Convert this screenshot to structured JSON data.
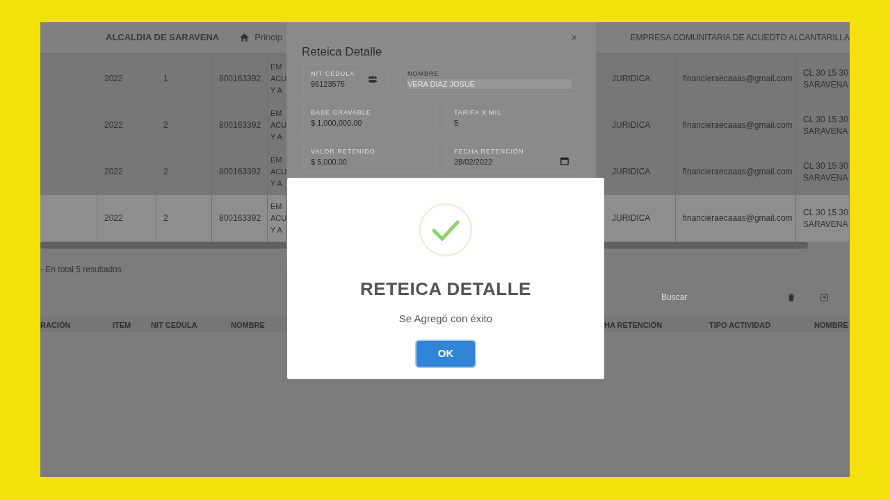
{
  "header": {
    "organization": "ALCALDIA DE SARAVENA",
    "nav_link": "Princip",
    "company": "EMPRESA COMUNITARIA DE ACUEDTO ALCANTARILLA"
  },
  "table": {
    "rows": [
      {
        "cells": [
          "2022",
          "1",
          "800163392",
          "EM\nACU\nY A",
          "JURIDICA",
          "financieraecaaas@gmail.com",
          "CL 30 15 30\nSARAVENA"
        ],
        "selected": false
      },
      {
        "cells": [
          "2022",
          "2",
          "800163392",
          "EM\nACU\nY A",
          "JURIDICA",
          "financieraecaaas@gmail.com",
          "CL 30 15 30\nSARAVENA"
        ],
        "selected": false
      },
      {
        "cells": [
          "2022",
          "2",
          "800163392",
          "EM\nACU\nY A",
          "JURIDICA",
          "financieraecaaas@gmail.com",
          "CL 30 15 30\nSARAVENA"
        ],
        "selected": false
      },
      {
        "cells": [
          "2022",
          "2",
          "800163392",
          "EM\nACU\nY A",
          "JURIDICA",
          "financieraecaaas@gmail.com",
          "CL 30 15 30\nSARAVENA"
        ],
        "selected": true
      }
    ]
  },
  "results_summary": "- En total 5 resultados",
  "search": {
    "placeholder": "Buscar"
  },
  "detail_table": {
    "columns": [
      "RACIÓN",
      "ITEM",
      "NIT CEDULA",
      "NOMBRE",
      "HA RETENCIÓN",
      "TIPO ACTIVIDAD",
      "NOMBRE"
    ]
  },
  "detail_modal": {
    "title": "Reteica Detalle",
    "close": "×",
    "fields": [
      {
        "label": "NIT CEDULA",
        "value": "96123575",
        "kind": "lookup"
      },
      {
        "label": "NOMBRE",
        "value": "VERA DIAZ JOSUE",
        "kind": "readonly"
      },
      {
        "label": "BASE GRAVABLE",
        "value": "$ 1,000,000.00",
        "kind": "text"
      },
      {
        "label": "TARIFA X MIL",
        "value": "5",
        "kind": "text"
      },
      {
        "label": "VALOR RETENIDO",
        "value": "$ 5,000.00",
        "kind": "text"
      },
      {
        "label": "FECHA RETENCIÓN",
        "value": "28/02/2022",
        "kind": "date"
      }
    ]
  },
  "alert": {
    "title": "RETEICA DETALLE",
    "message": "Se Agregó con éxito",
    "button": "OK"
  }
}
